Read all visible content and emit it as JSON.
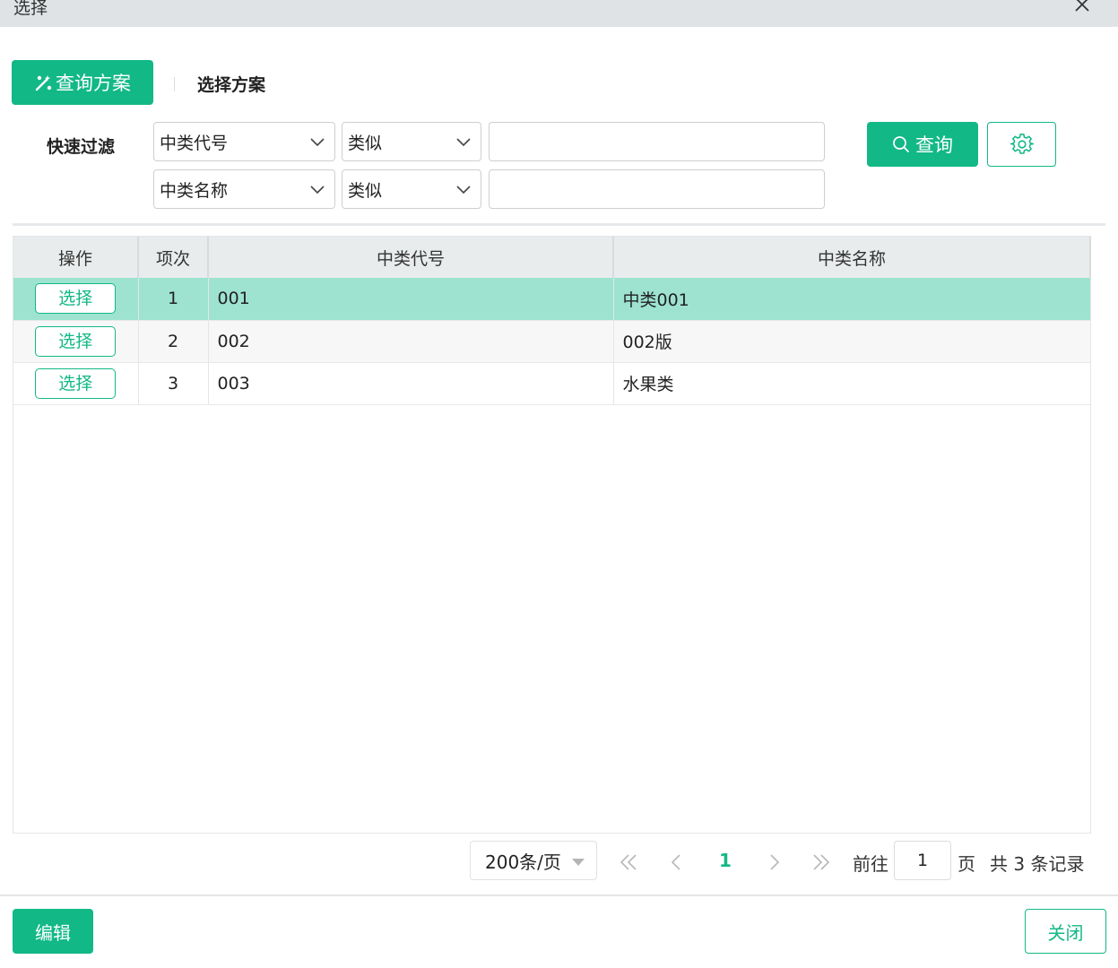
{
  "dialog": {
    "title": "选择"
  },
  "tabs": {
    "active_label": "查询方案",
    "other_label": "选择方案"
  },
  "filter": {
    "label": "快速过滤",
    "rows": [
      {
        "field": "中类代号",
        "operator": "类似",
        "value": ""
      },
      {
        "field": "中类名称",
        "operator": "类似",
        "value": ""
      }
    ],
    "query_label": "查询"
  },
  "table": {
    "columns": [
      "操作",
      "项次",
      "中类代号",
      "中类名称"
    ],
    "rows": [
      {
        "action": "选择",
        "index": "1",
        "code": "001",
        "name": "中类001",
        "selected": true
      },
      {
        "action": "选择",
        "index": "2",
        "code": "002",
        "name": "002版",
        "selected": false
      },
      {
        "action": "选择",
        "index": "3",
        "code": "003",
        "name": "水果类",
        "selected": false
      }
    ]
  },
  "pagination": {
    "page_size": "200条/页",
    "current_page": "1",
    "goto_prefix": "前往",
    "goto_value": "1",
    "goto_suffix": "页",
    "total_text": "共 3 条记录"
  },
  "footer": {
    "edit_label": "编辑",
    "close_label": "关闭"
  },
  "colors": {
    "accent": "#12b886",
    "selected_row": "#9de3d0",
    "titlebar": "#dfe3e6"
  }
}
